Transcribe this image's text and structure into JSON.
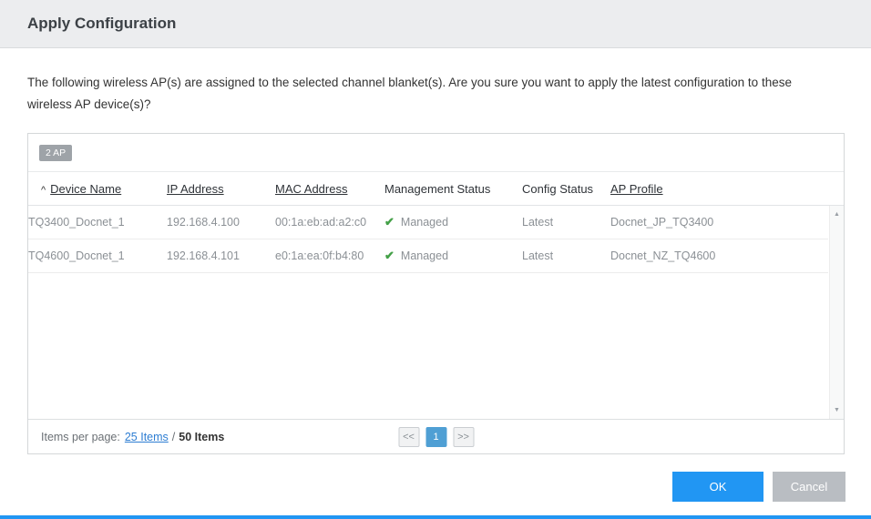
{
  "header": {
    "title": "Apply Configuration"
  },
  "message": "The following wireless AP(s) are assigned to the selected channel blanket(s). Are you sure you want to apply the latest configuration to these wireless AP device(s)?",
  "table": {
    "badge": "2 AP",
    "icons": {
      "sort_asc": "^",
      "managed_check": "✔",
      "scroll_up": "▲",
      "scroll_down": "▼"
    },
    "columns": [
      {
        "key": "device_name",
        "label": "Device Name",
        "sortable": true,
        "sorted": "asc"
      },
      {
        "key": "ip_address",
        "label": "IP Address",
        "sortable": true
      },
      {
        "key": "mac_address",
        "label": "MAC Address",
        "sortable": true
      },
      {
        "key": "management_status",
        "label": "Management Status",
        "sortable": false
      },
      {
        "key": "config_status",
        "label": "Config Status",
        "sortable": false
      },
      {
        "key": "ap_profile",
        "label": "AP Profile",
        "sortable": true
      }
    ],
    "rows": [
      {
        "device_name": "TQ3400_Docnet_1",
        "ip_address": "192.168.4.100",
        "mac_address": "00:1a:eb:ad:a2:c0",
        "management_status": "Managed",
        "config_status": "Latest",
        "ap_profile": "Docnet_JP_TQ3400"
      },
      {
        "device_name": "TQ4600_Docnet_1",
        "ip_address": "192.168.4.101",
        "mac_address": "e0:1a:ea:0f:b4:80",
        "management_status": "Managed",
        "config_status": "Latest",
        "ap_profile": "Docnet_NZ_TQ4600"
      }
    ]
  },
  "pagination": {
    "items_per_page_label": "Items per page:",
    "page_size_link": "25 Items",
    "separator": "/",
    "total_items": "50 Items",
    "prev": "<<",
    "current_page": "1",
    "next": ">>"
  },
  "actions": {
    "ok": "OK",
    "cancel": "Cancel"
  },
  "colors": {
    "accent_blue": "#2196f3",
    "active_page_blue": "#4f9fd4",
    "check_green": "#43a047",
    "header_gray": "#ecedef"
  }
}
